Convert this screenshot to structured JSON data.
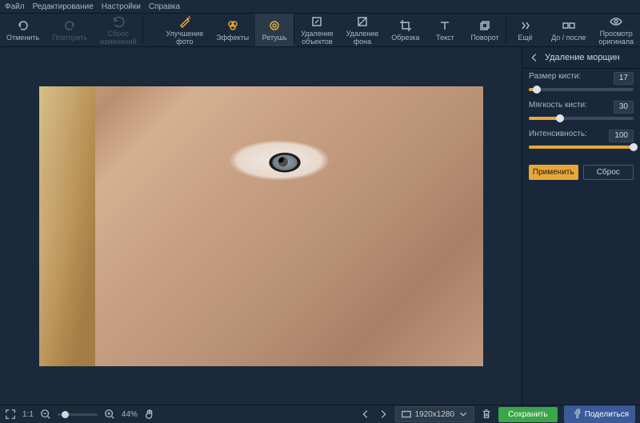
{
  "menu": {
    "file": "Файл",
    "edit": "Редактирование",
    "settings": "Настройки",
    "help": "Справка"
  },
  "toolbar": {
    "undo": "Отменить",
    "redo": "Повторить",
    "reset": "Сброс\nизменений",
    "enhance": "Улучшение\nфото",
    "effects": "Эффекты",
    "retouch": "Ретушь",
    "remove_obj": "Удаление\nобъектов",
    "remove_bg": "Удаление\nфона",
    "crop": "Обрезка",
    "text": "Текст",
    "rotate": "Поворот",
    "more": "Ещё",
    "before_after": "До / после",
    "original": "Просмотр\nоригинала"
  },
  "panel": {
    "title": "Удаление морщин",
    "brush_size_label": "Размер кисти:",
    "brush_size_val": "17",
    "softness_label": "Мягкость кисти:",
    "softness_val": "30",
    "intensity_label": "Интенсивность:",
    "intensity_val": "100",
    "apply": "Применить",
    "reset": "Сброс"
  },
  "status": {
    "fit": "1:1",
    "zoom": "44%",
    "dimensions": "1920x1280",
    "save": "Сохранить",
    "share": "Поделиться"
  }
}
